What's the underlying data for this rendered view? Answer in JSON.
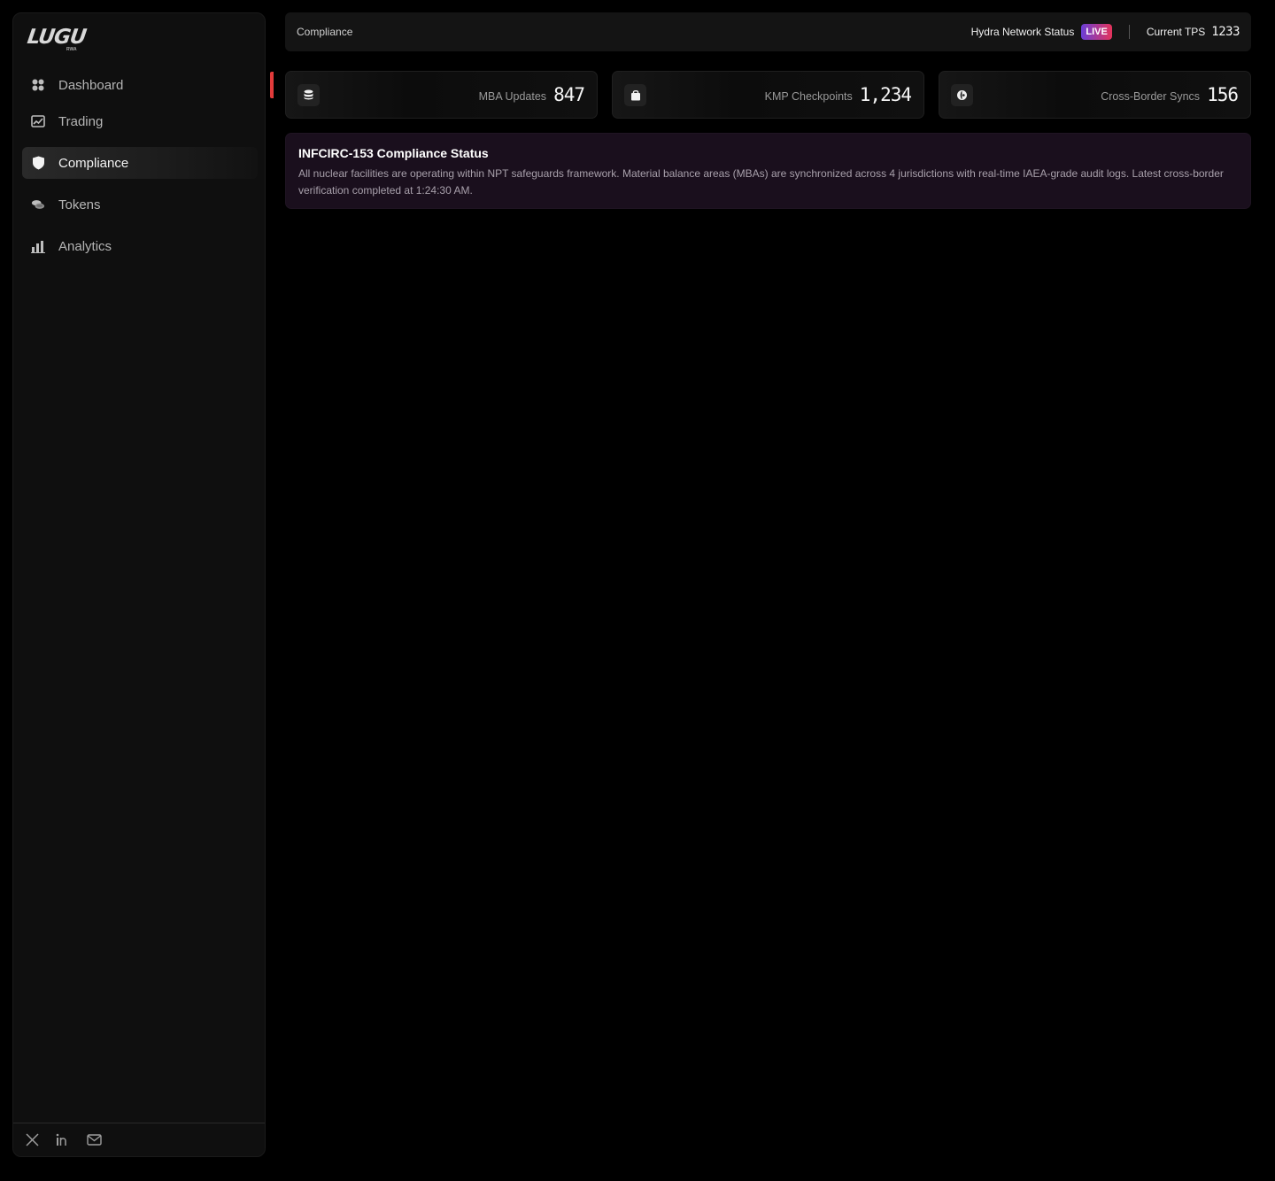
{
  "brand": {
    "logo_text": "LUGU",
    "logo_sub": "RWA"
  },
  "sidebar": {
    "items": [
      {
        "label": "Dashboard",
        "icon": "grid-icon"
      },
      {
        "label": "Trading",
        "icon": "chart-image-icon"
      },
      {
        "label": "Compliance",
        "icon": "shield-icon",
        "active": true
      },
      {
        "label": "Tokens",
        "icon": "coins-icon"
      },
      {
        "label": "Analytics",
        "icon": "bar-chart-icon"
      }
    ],
    "footer_icons": [
      "x-twitter-icon",
      "linkedin-icon",
      "mail-icon"
    ]
  },
  "header": {
    "breadcrumb": "Compliance",
    "network_status_label": "Hydra Network Status",
    "live_badge": "LIVE",
    "tps_label": "Current TPS",
    "tps_value": "1233"
  },
  "stats": [
    {
      "label": "MBA Updates",
      "value": "847",
      "icon": "database-icon"
    },
    {
      "label": "KMP Checkpoints",
      "value": "1,234",
      "icon": "bag-icon"
    },
    {
      "label": "Cross-Border Syncs",
      "value": "156",
      "icon": "globe-icon"
    }
  ],
  "banner": {
    "title": "INFCIRC-153 Compliance Status",
    "text": "All nuclear facilities are operating within NPT safeguards framework. Material balance areas (MBAs) are synchronized across 4 jurisdictions with real-time IAEA-grade audit logs. Latest cross-border verification completed at 1:24:30 AM."
  },
  "colors": {
    "accent_red": "#e23b3b",
    "live_gradient_start": "#6a3fd8",
    "live_gradient_end": "#e5335a",
    "banner_bg": "#1a0f1d"
  }
}
